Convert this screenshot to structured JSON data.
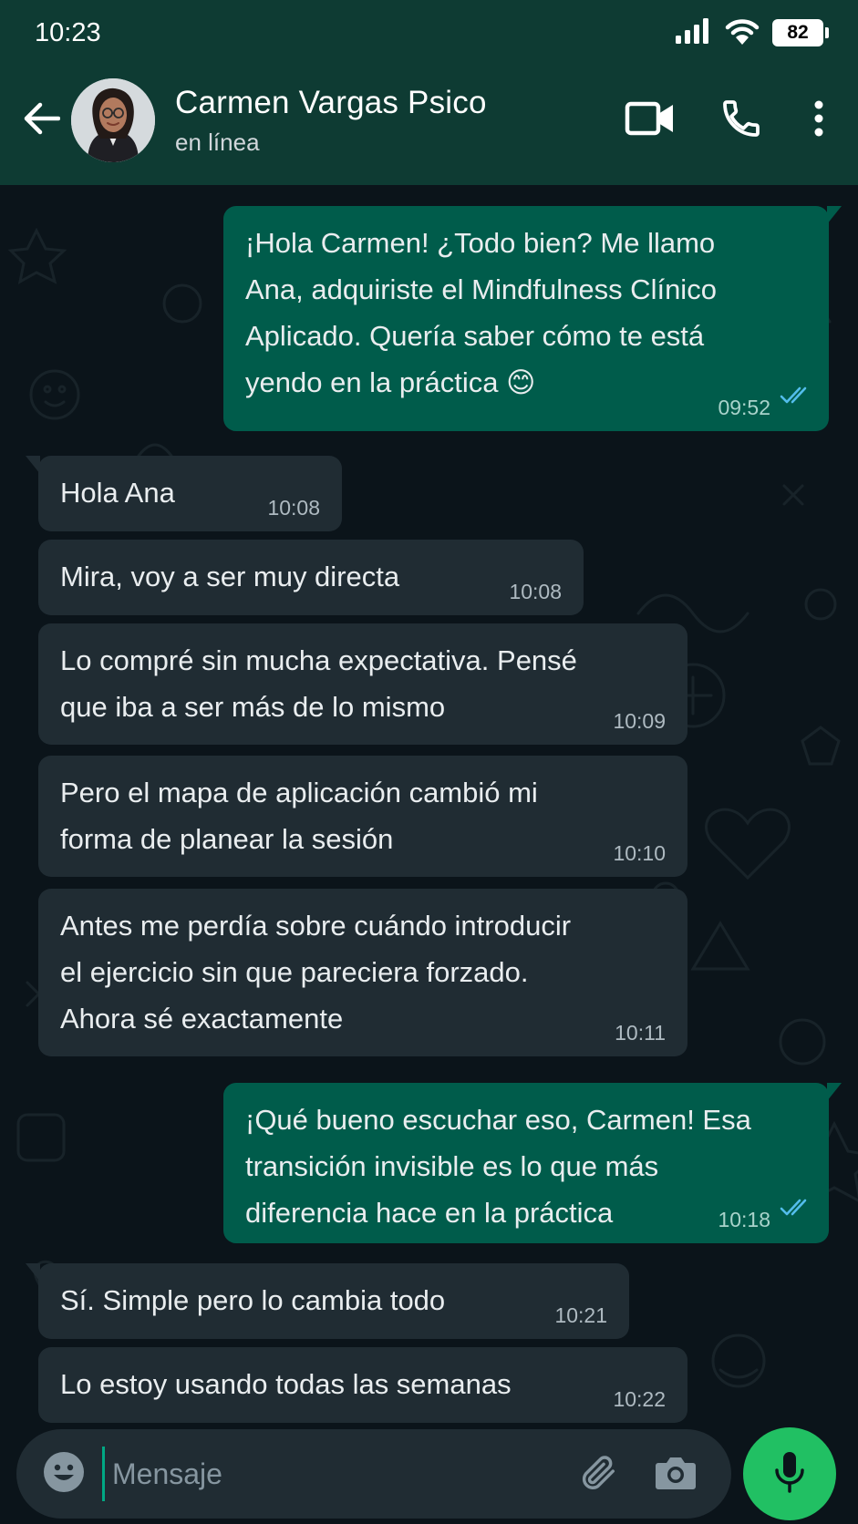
{
  "status_bar": {
    "time": "10:23",
    "battery": "82",
    "icons": [
      "signal-icon",
      "wifi-icon",
      "battery-icon"
    ]
  },
  "header": {
    "contact_name": "Carmen Vargas Psico",
    "contact_status": "en línea",
    "icons": [
      "back-arrow-icon",
      "video-call-icon",
      "phone-icon",
      "more-options-icon"
    ]
  },
  "messages": [
    {
      "direction": "out",
      "text": "¡Hola Carmen! ¿Todo bien? Me llamo\nAna, adquiriste el Mindfulness Clínico\nAplicado. Quería saber cómo te está\nyendo en la práctica 😊",
      "time": "09:52",
      "status": "read"
    },
    {
      "direction": "in",
      "text": "Hola Ana",
      "time": "10:08"
    },
    {
      "direction": "in",
      "text": "Mira, voy a ser muy directa",
      "time": "10:08"
    },
    {
      "direction": "in",
      "text": "Lo compré sin mucha expectativa. Pensé\nque iba a ser más de lo mismo",
      "time": "10:09"
    },
    {
      "direction": "in",
      "text": "Pero el mapa de aplicación cambió mi\nforma de planear la sesión",
      "time": "10:10"
    },
    {
      "direction": "in",
      "text": "Antes me perdía sobre cuándo introducir\nel ejercicio sin que pareciera forzado.\nAhora sé exactamente",
      "time": "10:11"
    },
    {
      "direction": "out",
      "text": "¡Qué bueno escuchar eso, Carmen! Esa\ntransición invisible es lo que más\ndiferencia hace en la práctica",
      "time": "10:18",
      "status": "read"
    },
    {
      "direction": "in",
      "text": "Sí. Simple pero lo cambia todo",
      "time": "10:21"
    },
    {
      "direction": "in",
      "text": "Lo estoy usando todas las semanas",
      "time": "10:22"
    }
  ],
  "composer": {
    "placeholder": "Mensaje",
    "value": "",
    "icons": [
      "emoji-icon",
      "attach-icon",
      "camera-icon",
      "microphone-icon"
    ]
  },
  "colors": {
    "header_bg": "#0e3b33",
    "chat_bg": "#0b141a",
    "incoming_bubble": "#202c33",
    "outgoing_bubble": "#005c4b",
    "read_ticks": "#53bdeb",
    "mic_button": "#21c063"
  }
}
